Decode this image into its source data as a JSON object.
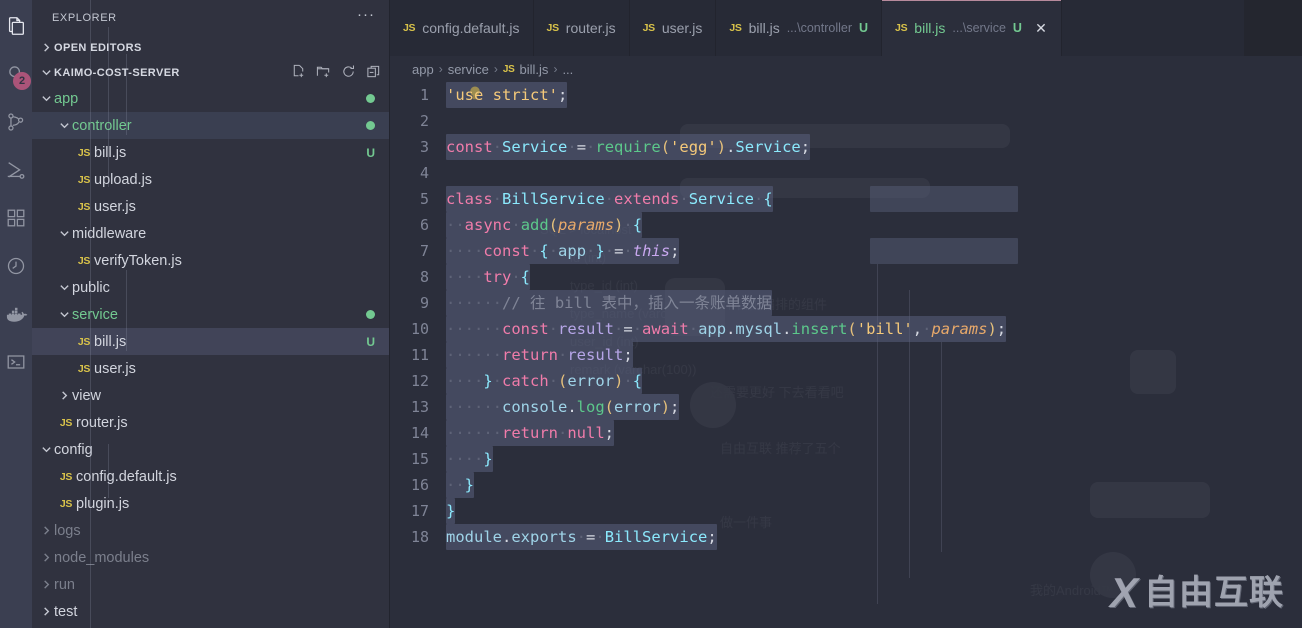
{
  "activity_bar": {
    "items": [
      {
        "name": "explorer-icon",
        "badge": null
      },
      {
        "name": "search-icon",
        "badge": "2"
      },
      {
        "name": "source-control-icon",
        "badge": null
      },
      {
        "name": "run-debug-icon",
        "badge": null
      },
      {
        "name": "extensions-icon",
        "badge": null
      },
      {
        "name": "timeline-icon",
        "badge": null
      },
      {
        "name": "docker-icon",
        "badge": null
      },
      {
        "name": "remote-explorer-icon",
        "badge": null
      }
    ]
  },
  "sidebar": {
    "title": "EXPLORER",
    "more_actions": "···",
    "sections": [
      {
        "label": "OPEN EDITORS",
        "expanded": false
      },
      {
        "label": "KAIMO-COST-SERVER",
        "expanded": true
      }
    ],
    "project_actions": [
      "new-file",
      "new-folder",
      "refresh",
      "collapse-all"
    ],
    "tree": [
      {
        "label": "app",
        "type": "folder",
        "depth": 1,
        "expanded": true,
        "green": true,
        "dot": true,
        "dim": false,
        "badge": null
      },
      {
        "label": "controller",
        "type": "folder",
        "depth": 2,
        "expanded": true,
        "green": true,
        "dot": true,
        "dim": false,
        "badge": null,
        "focused": true
      },
      {
        "label": "bill.js",
        "type": "file",
        "depth": 3,
        "badge": "U",
        "dim": false
      },
      {
        "label": "upload.js",
        "type": "file",
        "depth": 3,
        "badge": null,
        "dim": false
      },
      {
        "label": "user.js",
        "type": "file",
        "depth": 3,
        "badge": null,
        "dim": false
      },
      {
        "label": "middleware",
        "type": "folder",
        "depth": 2,
        "expanded": true,
        "green": false,
        "dot": false,
        "dim": false,
        "badge": null
      },
      {
        "label": "verifyToken.js",
        "type": "file",
        "depth": 3,
        "badge": null,
        "dim": false
      },
      {
        "label": "public",
        "type": "folder",
        "depth": 2,
        "expanded": true,
        "green": false,
        "dot": false,
        "dim": false,
        "badge": null
      },
      {
        "label": "service",
        "type": "folder",
        "depth": 2,
        "expanded": true,
        "green": true,
        "dot": true,
        "dim": false,
        "badge": null
      },
      {
        "label": "bill.js",
        "type": "file",
        "depth": 3,
        "badge": "U",
        "dim": false,
        "selected": true
      },
      {
        "label": "user.js",
        "type": "file",
        "depth": 3,
        "badge": null,
        "dim": false
      },
      {
        "label": "view",
        "type": "folder",
        "depth": 2,
        "expanded": false,
        "green": false,
        "dot": false,
        "dim": false,
        "badge": null
      },
      {
        "label": "router.js",
        "type": "file",
        "depth": 2,
        "badge": null,
        "dim": false
      },
      {
        "label": "config",
        "type": "folder",
        "depth": 1,
        "expanded": true,
        "green": false,
        "dot": false,
        "dim": false,
        "badge": null
      },
      {
        "label": "config.default.js",
        "type": "file",
        "depth": 2,
        "badge": null,
        "dim": false
      },
      {
        "label": "plugin.js",
        "type": "file",
        "depth": 2,
        "badge": null,
        "dim": false
      },
      {
        "label": "logs",
        "type": "folder",
        "depth": 1,
        "expanded": false,
        "green": false,
        "dot": false,
        "dim": true,
        "badge": null
      },
      {
        "label": "node_modules",
        "type": "folder",
        "depth": 1,
        "expanded": false,
        "green": false,
        "dot": false,
        "dim": true,
        "badge": null
      },
      {
        "label": "run",
        "type": "folder",
        "depth": 1,
        "expanded": false,
        "green": false,
        "dot": false,
        "dim": true,
        "badge": null
      },
      {
        "label": "test",
        "type": "folder",
        "depth": 1,
        "expanded": false,
        "green": false,
        "dot": false,
        "dim": false,
        "badge": null
      }
    ]
  },
  "tabs": [
    {
      "icon": "js",
      "name": "config.default.js",
      "desc": "",
      "badge": "",
      "active": false,
      "closable": false
    },
    {
      "icon": "js",
      "name": "router.js",
      "desc": "",
      "badge": "",
      "active": false,
      "closable": false
    },
    {
      "icon": "js",
      "name": "user.js",
      "desc": "",
      "badge": "",
      "active": false,
      "closable": false
    },
    {
      "icon": "js",
      "name": "bill.js",
      "desc": "...\\controller",
      "badge": "U",
      "active": false,
      "closable": false
    },
    {
      "icon": "js",
      "name": "bill.js",
      "desc": "...\\service",
      "badge": "U",
      "active": true,
      "closable": true,
      "close_glyph": "✕"
    }
  ],
  "breadcrumb": {
    "items": [
      "app",
      "service",
      "bill.js",
      "..."
    ],
    "separator": "›",
    "file_icon": "js"
  },
  "editor": {
    "language": "javascript",
    "lightbulb_line": 2,
    "lines": [
      {
        "n": "1",
        "text": "'use strict';"
      },
      {
        "n": "2",
        "text": ""
      },
      {
        "n": "3",
        "text": "const Service = require('egg').Service;"
      },
      {
        "n": "4",
        "text": ""
      },
      {
        "n": "5",
        "text": "class BillService extends Service {"
      },
      {
        "n": "6",
        "text": "  async add(params) {"
      },
      {
        "n": "7",
        "text": "    const { app } = this;"
      },
      {
        "n": "8",
        "text": "    try {"
      },
      {
        "n": "9",
        "text": "      // 往 bill 表中，插入一条账单数据"
      },
      {
        "n": "10",
        "text": "      const result = await app.mysql.insert('bill', params);"
      },
      {
        "n": "11",
        "text": "      return result;"
      },
      {
        "n": "12",
        "text": "    } catch (error) {"
      },
      {
        "n": "13",
        "text": "      console.log(error);"
      },
      {
        "n": "14",
        "text": "      return null;"
      },
      {
        "n": "15",
        "text": "    }"
      },
      {
        "n": "16",
        "text": "  }"
      },
      {
        "n": "17",
        "text": "}"
      },
      {
        "n": "18",
        "text": "module.exports = BillService;"
      }
    ]
  },
  "watermark": {
    "x_logo": "X",
    "text": "自由互联"
  },
  "colors": {
    "editor_bg": "#2b2e3b",
    "sidebar_bg": "#303340",
    "activity_bg": "#3b3f51",
    "tabbar_bg": "#272a36",
    "accent_green": "#73c991",
    "accent_pink": "#f07caa",
    "badge_pink": "#f06292",
    "active_tab_border": "#b78a9c",
    "keyword": "#f07caa",
    "type": "#8be9fd",
    "function": "#5cc88b",
    "string": "#f5c97a",
    "variable": "#b7a6e8",
    "param": "#e8a96a",
    "comment": "#7f8496",
    "selection": "rgba(90,97,125,0.55)"
  }
}
